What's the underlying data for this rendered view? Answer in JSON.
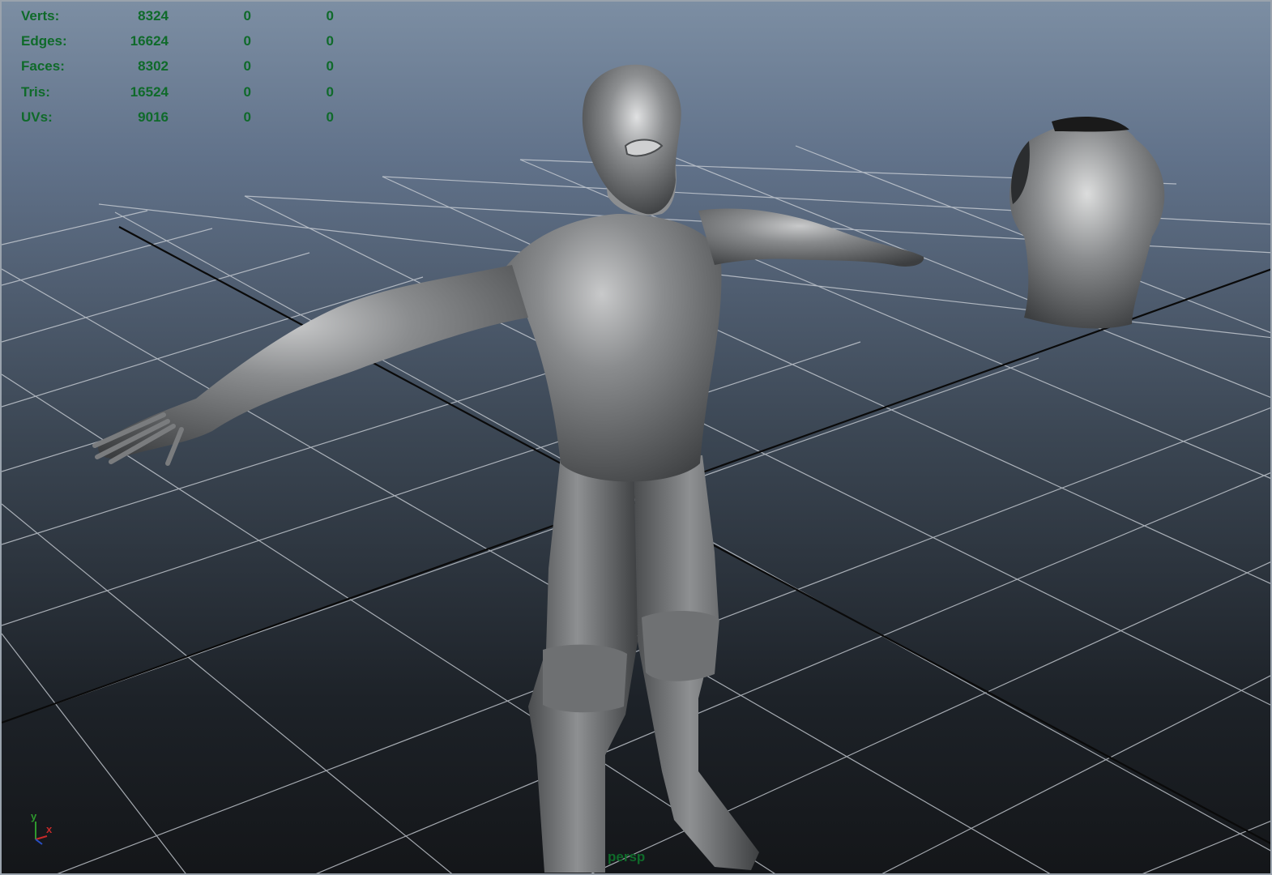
{
  "hud": {
    "rows": [
      {
        "label": "Verts:",
        "v1": "8324",
        "v2": "0",
        "v3": "0"
      },
      {
        "label": "Edges:",
        "v1": "16624",
        "v2": "0",
        "v3": "0"
      },
      {
        "label": "Faces:",
        "v1": "8302",
        "v2": "0",
        "v3": "0"
      },
      {
        "label": "Tris:",
        "v1": "16524",
        "v2": "0",
        "v3": "0"
      },
      {
        "label": "UVs:",
        "v1": "9016",
        "v2": "0",
        "v3": "0"
      }
    ]
  },
  "viewport": {
    "camera_label": "persp",
    "axis_labels": {
      "y": "y",
      "x": "x"
    }
  },
  "colors": {
    "hud_text": "#0f6a2a",
    "grid_line": "#c9ced5",
    "axis_line": "#0a0a0a",
    "model": "#7e8082"
  }
}
